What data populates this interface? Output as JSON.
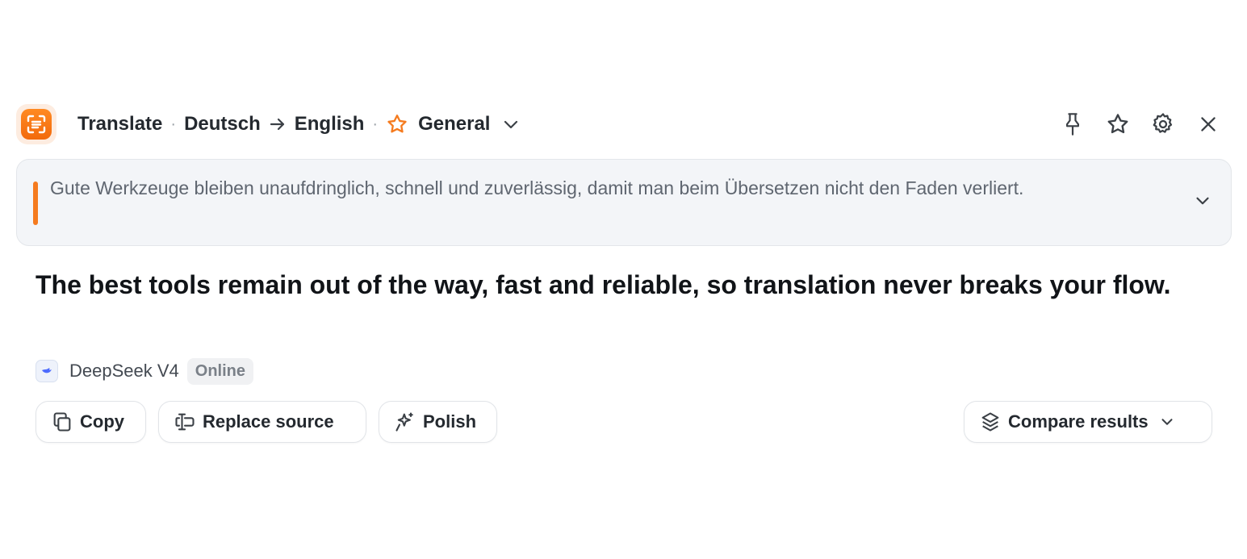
{
  "header": {
    "mode": "Translate",
    "source_lang": "Deutsch",
    "target_lang": "English",
    "profile": "General",
    "icons": [
      "pin-icon",
      "star-icon",
      "gear-icon",
      "close-icon"
    ]
  },
  "source": {
    "text": "Gute Werkzeuge bleiben unaufdringlich, schnell und zuverlässig, damit man beim Übersetzen nicht den Faden verliert."
  },
  "result": {
    "text": "The best tools remain out of the way, fast and reliable, so translation never breaks your flow."
  },
  "model": {
    "name": "DeepSeek V4",
    "status": "Online"
  },
  "actions": {
    "copy": "Copy",
    "replace_source": "Replace source",
    "polish": "Polish",
    "compare": "Compare results"
  },
  "colors": {
    "accent": "#f57b1f",
    "source_bg": "#f3f5f8",
    "text": "#111418"
  }
}
